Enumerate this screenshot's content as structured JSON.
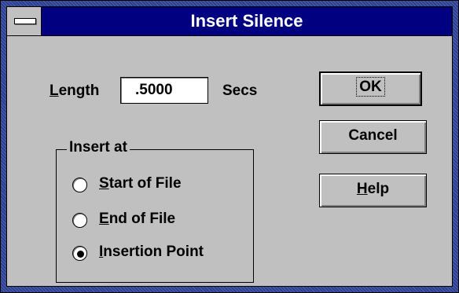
{
  "window": {
    "title": "Insert Silence"
  },
  "length": {
    "label_mnemonic": "L",
    "label_rest": "ength",
    "value": ".5000",
    "unit": "Secs"
  },
  "insert_at": {
    "group_label": "Insert at",
    "options": [
      {
        "mnemonic": "S",
        "rest": "tart of File",
        "selected": false
      },
      {
        "mnemonic": "E",
        "rest": "nd of File",
        "selected": false
      },
      {
        "mnemonic": "I",
        "rest": "nsertion Point",
        "selected": true
      }
    ]
  },
  "buttons": {
    "ok": "OK",
    "cancel": "Cancel",
    "help_mnemonic": "H",
    "help_rest": "elp"
  }
}
